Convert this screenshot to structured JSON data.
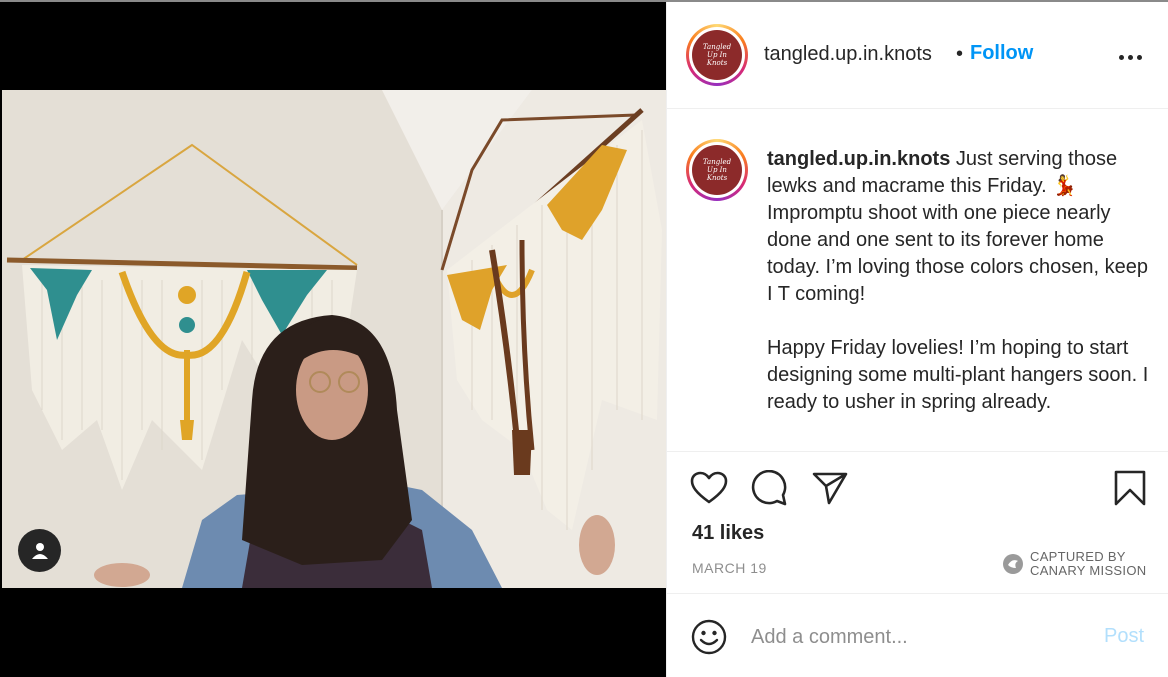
{
  "post": {
    "username": "tangled.up.in.knots",
    "separator": "•",
    "follow_label": "Follow",
    "avatar_logo_lines": [
      "Tangled",
      "Up In",
      "Knots"
    ],
    "caption_text": " Just serving those lewks and macrame this Friday. 💃 Impromptu shoot with one piece nearly done and one sent to its forever home today. I’m loving those colors chosen, keep I T coming!\n\nHappy Friday lovelies! I’m hoping to start designing some multi-plant hangers soon. I ready to usher in spring already.",
    "likes": "41 likes",
    "date": "MARCH 19"
  },
  "watermark": {
    "line1": "CAPTURED BY",
    "line2": "CANARY MISSION"
  },
  "comment": {
    "placeholder": "Add a comment...",
    "post_label": "Post"
  },
  "icons": {
    "more": "more-options-icon",
    "like": "heart-icon",
    "comment": "comment-bubble-icon",
    "share": "paper-plane-icon",
    "save": "bookmark-icon",
    "emoji": "smiley-icon",
    "user_tag": "user-tag-icon"
  },
  "colors": {
    "follow": "#0095f6",
    "post_disabled": "#b2dffc",
    "logo_bg": "#8c2a2a"
  }
}
